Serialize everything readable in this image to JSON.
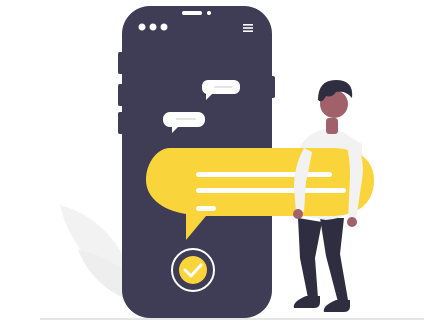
{
  "illustration": {
    "colors": {
      "phone_body": "#3f3d56",
      "accent": "#f9d43a",
      "bubble_white": "#ffffff",
      "leaf": "#f2f2f2",
      "ground": "#e6e6e6",
      "skin": "#a0616a",
      "hair": "#2f2e41",
      "shirt": "#f2f2f2",
      "pants": "#2f2e41"
    },
    "icons": {
      "phone": "smartphone-icon",
      "menu": "hamburger-menu-icon",
      "status_dots": "three-dots-icon",
      "check": "checkmark-circle-icon",
      "chat": "chat-bubble-icon"
    }
  }
}
